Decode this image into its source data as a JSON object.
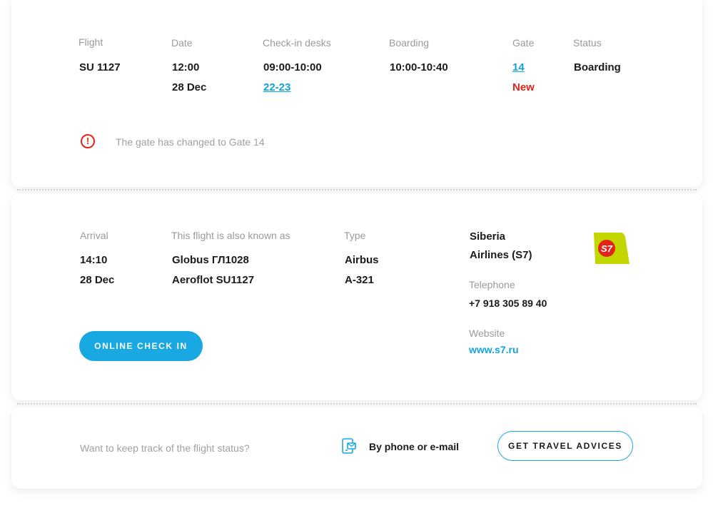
{
  "flight_info": {
    "flight_label": "Flight",
    "flight_value": "SU 1127",
    "date_label": "Date",
    "time_value": "12:00",
    "date_value": "28 Dec",
    "checkin_label": "Check-in desks",
    "checkin_time": "09:00-10:00",
    "checkin_desks": "22-23",
    "boarding_label": "Boarding",
    "boarding_value": "10:00-10:40",
    "gate_label": "Gate",
    "gate_value": "14",
    "gate_badge": "New",
    "status_label": "Status",
    "status_value": "Boarding"
  },
  "alert": {
    "icon": "alert-circle-icon",
    "glyph": "!",
    "message": "The gate has changed to Gate 14",
    "color": "#e2231a"
  },
  "details": {
    "arrival_label": "Arrival",
    "arrival_time": "14:10",
    "arrival_date": "28 Dec",
    "aka_label": "This flight is also known as",
    "aka_1": "Globus ГЛ1028",
    "aka_2": "Aeroflot SU1127",
    "type_label": "Type",
    "type_line1": "Airbus",
    "type_line2": "A-321",
    "checkin_button": "ONLINE CHECK IN"
  },
  "airline": {
    "name_line1": "Siberia",
    "name_line2": "Airlines (S7)",
    "logo_text": "S7",
    "logo_color": "#c4d600",
    "logo_circle_color": "#e2231a",
    "telephone_label": "Telephone",
    "telephone_value": "+7 918 305 89 40",
    "website_label": "Website",
    "website_value": "www.s7.ru"
  },
  "tracking": {
    "prompt": "Want to keep track of the flight status?",
    "icon": "phone-mail-icon",
    "channel_label": "By phone or e-mail",
    "advice_button": "GET TRAVEL ADVICES"
  },
  "colors": {
    "accent": "#1aa8e3",
    "link": "#12a3de",
    "alert": "#e2231a"
  }
}
